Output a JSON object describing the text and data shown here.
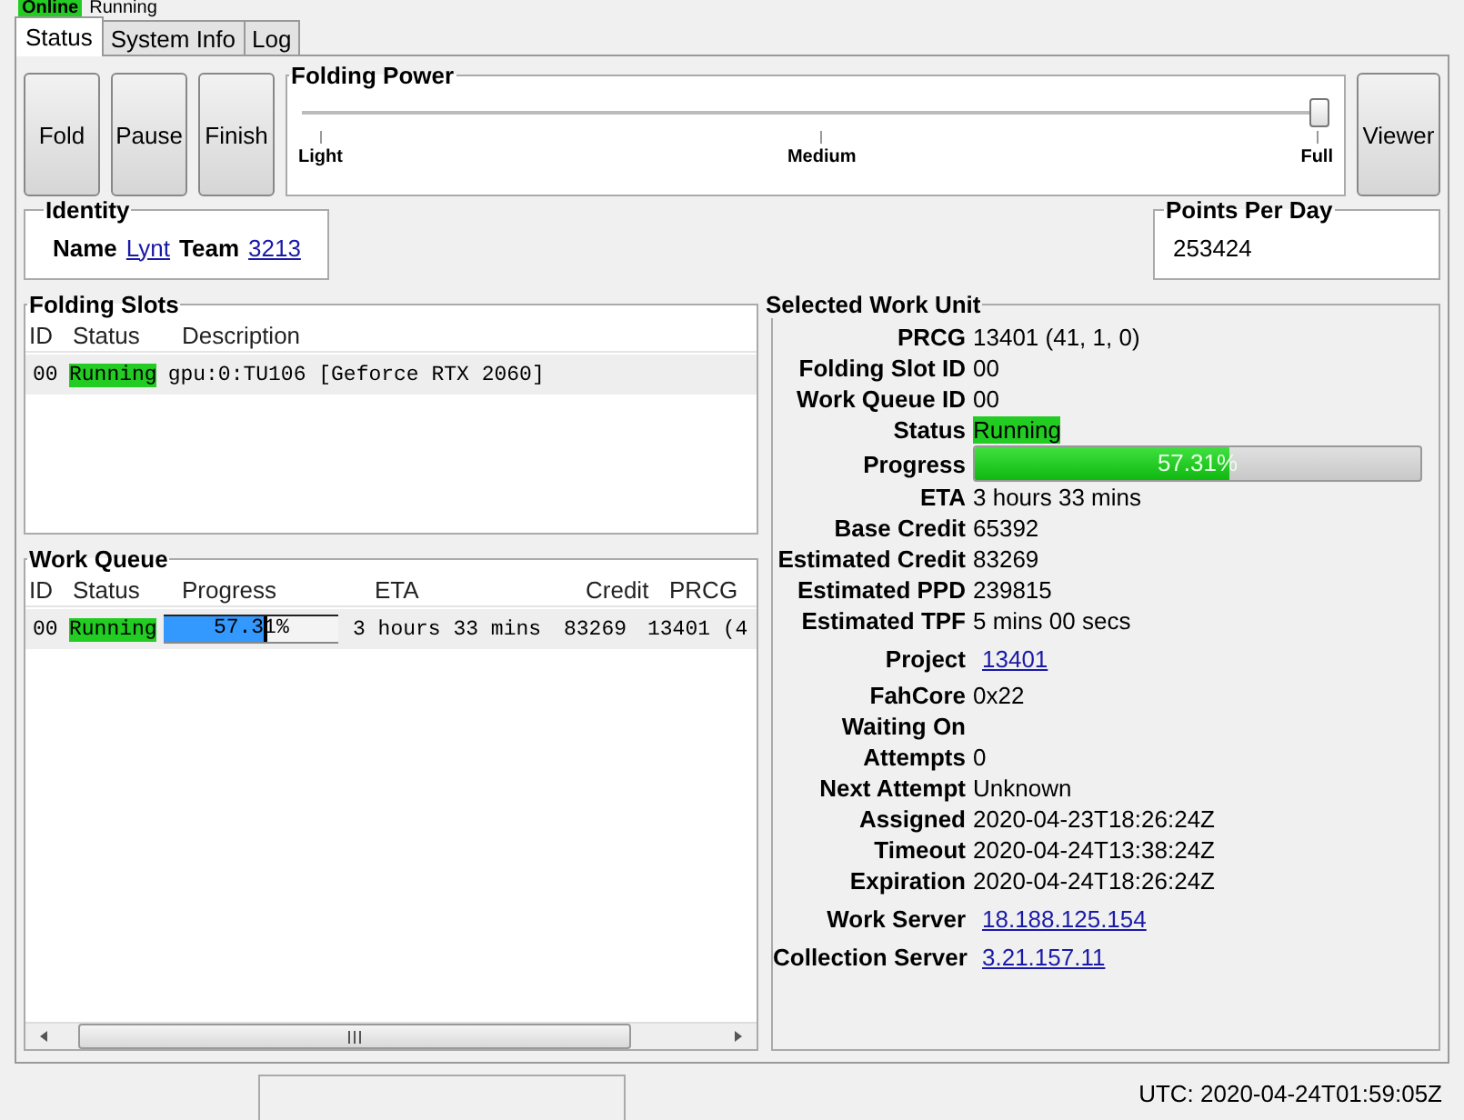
{
  "header": {
    "state": "Online",
    "status": "Running"
  },
  "tabs": [
    {
      "label": "Status",
      "selected": true
    },
    {
      "label": "System Info",
      "selected": false
    },
    {
      "label": "Log",
      "selected": false
    }
  ],
  "actions": [
    "Fold",
    "Pause",
    "Finish"
  ],
  "folding_power": {
    "title": "Folding Power",
    "level": 1,
    "ticks": [
      "Light",
      "Medium",
      "Full"
    ]
  },
  "viewer_button": "Viewer",
  "identity": {
    "title": "Identity",
    "name_label": "Name",
    "name": "Lynt",
    "team_label": "Team",
    "team": "3213"
  },
  "points_per_day": {
    "title": "Points Per Day",
    "value": "253424"
  },
  "folding_slots": {
    "title": "Folding Slots",
    "columns": [
      "ID",
      "Status",
      "Description"
    ],
    "rows": [
      {
        "id": "00",
        "status": "Running",
        "description": "gpu:0:TU106 [Geforce RTX 2060]",
        "selected": true
      }
    ]
  },
  "work_queue": {
    "title": "Work Queue",
    "columns": [
      "ID",
      "Status",
      "Progress",
      "ETA",
      "Credit",
      "PRCG"
    ],
    "rows": [
      {
        "id": "00",
        "status": "Running",
        "progress": "57.31%",
        "level": 0.5731,
        "eta": "3 hours 33 mins",
        "credit": "83269",
        "prcg": "13401 (4",
        "selected": true
      }
    ]
  },
  "selected_work_unit": {
    "title": "Selected Work Unit",
    "fields": [
      {
        "kind": "text",
        "label": "PRCG",
        "value": "13401 (41, 1, 0)"
      },
      {
        "kind": "text",
        "label": "Folding Slot ID",
        "value": "00"
      },
      {
        "kind": "text",
        "label": "Work Queue ID",
        "value": "00"
      },
      {
        "kind": "status",
        "label": "Status",
        "value": "Running"
      },
      {
        "kind": "progress",
        "label": "Progress",
        "value": "57.31%",
        "level": 0.5731
      },
      {
        "kind": "text",
        "label": "ETA",
        "value": "3 hours 33 mins"
      },
      {
        "kind": "text",
        "label": "Base Credit",
        "value": "65392"
      },
      {
        "kind": "text",
        "label": "Estimated Credit",
        "value": "83269"
      },
      {
        "kind": "text",
        "label": "Estimated PPD",
        "value": "239815"
      },
      {
        "kind": "text",
        "label": "Estimated TPF",
        "value": "5 mins 00 secs"
      },
      {
        "kind": "link",
        "label": "Project",
        "value": "13401"
      },
      {
        "kind": "text",
        "label": "FahCore",
        "value": "0x22"
      },
      {
        "kind": "text",
        "label": "Waiting On"
      },
      {
        "kind": "text",
        "label": "Attempts",
        "value": "0"
      },
      {
        "kind": "text",
        "label": "Next Attempt",
        "value": "Unknown"
      },
      {
        "kind": "text",
        "label": "Assigned",
        "value": "2020-04-23T18:26:24Z"
      },
      {
        "kind": "text",
        "label": "Timeout",
        "value": "2020-04-24T13:38:24Z"
      },
      {
        "kind": "text",
        "label": "Expiration",
        "value": "2020-04-24T18:26:24Z"
      },
      {
        "kind": "link",
        "label": "Work Server",
        "value": "18.188.125.154"
      },
      {
        "kind": "link",
        "label": "Collection Server",
        "value": "3.21.157.11"
      }
    ]
  },
  "status_bar": {
    "utc": "UTC: 2020-04-24T01:59:05Z"
  }
}
